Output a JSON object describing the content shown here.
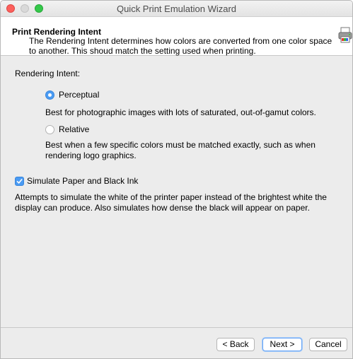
{
  "window": {
    "title": "Quick Print Emulation Wizard"
  },
  "header": {
    "title": "Print Rendering Intent",
    "description": "The Rendering Intent determines how colors are converted from one color space to another. This shoud match the setting used when printing."
  },
  "rendering_intent": {
    "label": "Rendering Intent:",
    "options": [
      {
        "label": "Perceptual",
        "selected": true,
        "description": "Best for photographic images with lots of saturated, out-of-gamut colors."
      },
      {
        "label": "Relative",
        "selected": false,
        "description": "Best when a few specific colors must be matched exactly, such as when rendering logo graphics."
      }
    ]
  },
  "simulate": {
    "label": "Simulate Paper and Black Ink",
    "checked": true,
    "description": "Attempts to simulate the white of the printer paper instead of the brightest white the display can produce. Also simulates how dense the black will appear on paper."
  },
  "buttons": {
    "back": "< Back",
    "next": "Next >",
    "cancel": "Cancel"
  },
  "colors": {
    "accent": "#4a9bf3",
    "close": "#fc605c",
    "zoom": "#34c84a"
  }
}
